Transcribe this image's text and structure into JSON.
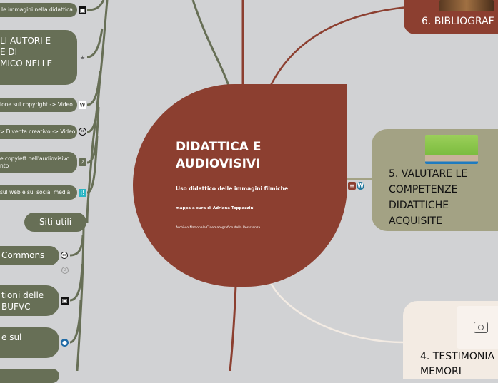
{
  "central": {
    "title": "DIDATTICA E AUDIOVISIVI",
    "subtitle": "Uso didattico delle immagini filmiche",
    "author": "mappa a cura di Adriana Toppazzini",
    "org": "Archivio Nazionale Cinematografico della Resistenza"
  },
  "left_nodes": [
    {
      "label": "le immagini nella didattica",
      "icon": "film-icon"
    },
    {
      "label": "LI AUTORI E\nE DI\nMICO NELLE",
      "icon": "attachment-icon"
    },
    {
      "label": "ione sul copyright -> Video",
      "icon": "wikipedia-icon"
    },
    {
      "label": "> Diventa creativo -> Video",
      "icon": "creative-commons-icon"
    },
    {
      "label": "e copyleft nell'audiovisivo.\nnto",
      "icon": "external-link-icon"
    },
    {
      "label": "sul web e sui social media",
      "icon": "info-icon"
    }
  ],
  "siti_utili": {
    "label": "Siti utili"
  },
  "siti_children": [
    {
      "label": "Commons",
      "icon": "creative-commons-icon",
      "badge": "2"
    },
    {
      "label": "tioni delle\nBUFVC",
      "icon": "film-icon"
    },
    {
      "label": "e sul",
      "icon": "globe-icon"
    }
  ],
  "right_nodes": {
    "bibliografia": "6. BIBLIOGRAF",
    "valutare": "5. VALUTARE LE COMPETENZE DIDATTICHE ACQUISITE",
    "testimonianze": "4. TESTIMONIA",
    "testimonianze_line2": "MEMORI"
  },
  "colors": {
    "background": "#d1d2d4",
    "central": "#8c3f30",
    "green": "#676f56",
    "olive": "#a3a284",
    "cream": "#f3ebe3"
  }
}
